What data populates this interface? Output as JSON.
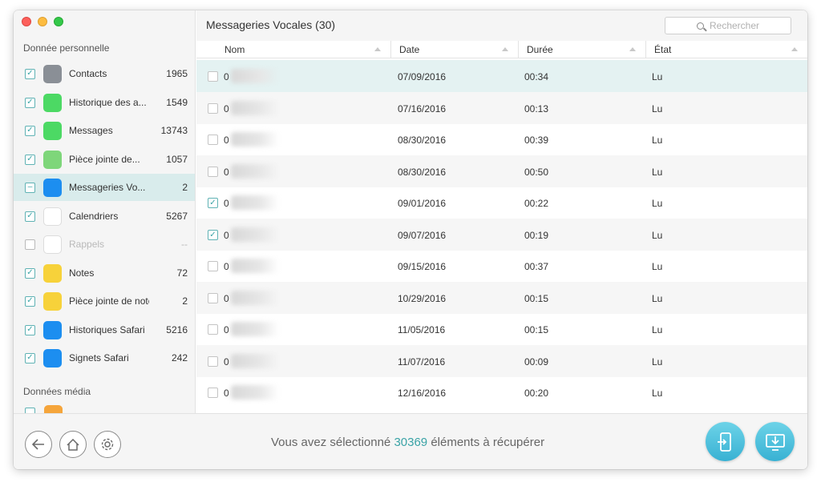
{
  "sidebar": {
    "section_personal": "Donnée personnelle",
    "section_media": "Données média",
    "items": [
      {
        "label": "Contacts",
        "count": "1965",
        "icon": "contacts-icon",
        "color": "#8a8f96"
      },
      {
        "label": "Historique des a...",
        "count": "1549",
        "icon": "phone-icon",
        "color": "#4cd964"
      },
      {
        "label": "Messages",
        "count": "13743",
        "icon": "messages-icon",
        "color": "#4cd964"
      },
      {
        "label": "Pièce jointe de...",
        "count": "1057",
        "icon": "message-attachment-icon",
        "color": "#7ed67a"
      },
      {
        "label": "Messageries Vo...",
        "count": "2",
        "icon": "voicemail-icon",
        "color": "#1c8ef0"
      },
      {
        "label": "Calendriers",
        "count": "5267",
        "icon": "calendar-icon",
        "color": "#ffffff"
      },
      {
        "label": "Rappels",
        "count": "--",
        "icon": "reminders-icon",
        "color": "#ffffff"
      },
      {
        "label": "Notes",
        "count": "72",
        "icon": "notes-icon",
        "color": "#f7d23a"
      },
      {
        "label": "Pièce jointe de note",
        "count": "2",
        "icon": "note-attachment-icon",
        "color": "#f7d23a"
      },
      {
        "label": "Historiques Safari",
        "count": "5216",
        "icon": "safari-history-icon",
        "color": "#1c8ef0"
      },
      {
        "label": "Signets Safari",
        "count": "242",
        "icon": "safari-bookmarks-icon",
        "color": "#1c8ef0"
      }
    ]
  },
  "main": {
    "title": "Messageries Vocales (30)",
    "search_placeholder": "Rechercher",
    "columns": {
      "name": "Nom",
      "date": "Date",
      "duration": "Durée",
      "state": "État"
    },
    "rows": [
      {
        "prefix": "0",
        "date": "07/09/2016",
        "duration": "00:34",
        "state": "Lu",
        "checked": false
      },
      {
        "prefix": "0",
        "date": "07/16/2016",
        "duration": "00:13",
        "state": "Lu",
        "checked": false
      },
      {
        "prefix": "0",
        "date": "08/30/2016",
        "duration": "00:39",
        "state": "Lu",
        "checked": false
      },
      {
        "prefix": "0",
        "date": "08/30/2016",
        "duration": "00:50",
        "state": "Lu",
        "checked": false
      },
      {
        "prefix": "0",
        "date": "09/01/2016",
        "duration": "00:22",
        "state": "Lu",
        "checked": true
      },
      {
        "prefix": "0",
        "date": "09/07/2016",
        "duration": "00:19",
        "state": "Lu",
        "checked": true
      },
      {
        "prefix": "0",
        "date": "09/15/2016",
        "duration": "00:37",
        "state": "Lu",
        "checked": false
      },
      {
        "prefix": "0",
        "date": "10/29/2016",
        "duration": "00:15",
        "state": "Lu",
        "checked": false
      },
      {
        "prefix": "0",
        "date": "11/05/2016",
        "duration": "00:15",
        "state": "Lu",
        "checked": false
      },
      {
        "prefix": "0",
        "date": "11/07/2016",
        "duration": "00:09",
        "state": "Lu",
        "checked": false
      },
      {
        "prefix": "0",
        "date": "12/16/2016",
        "duration": "00:20",
        "state": "Lu",
        "checked": false
      }
    ]
  },
  "footer": {
    "status_prefix": "Vous avez sélectionné ",
    "selected_count": "30369",
    "status_suffix": " éléments à récupérer"
  },
  "colors": {
    "accent": "#3aa3a6",
    "action": "#38b1d3"
  }
}
